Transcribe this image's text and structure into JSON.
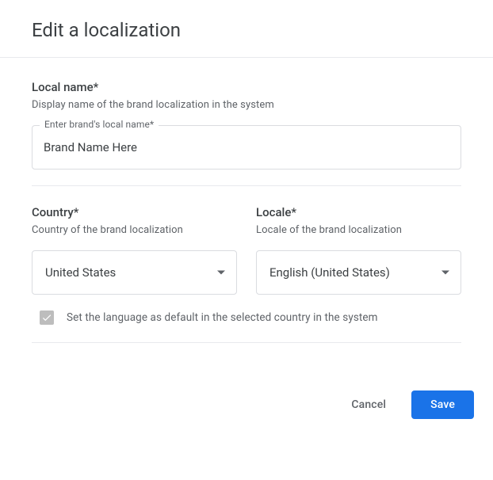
{
  "dialog": {
    "title": "Edit a localization"
  },
  "localName": {
    "label": "Local name*",
    "desc": "Display name of the brand localization in the system",
    "floatingLabel": "Enter brand's local name*",
    "value": "Brand Name Here"
  },
  "country": {
    "label": "Country*",
    "desc": "Country of the brand localization",
    "value": "United States"
  },
  "locale": {
    "label": "Locale*",
    "desc": "Locale of the brand localization",
    "value": "English (United States)"
  },
  "defaultCheckbox": {
    "label": "Set the language as default in the selected country in the system",
    "checked": true
  },
  "footer": {
    "cancel": "Cancel",
    "save": "Save"
  }
}
